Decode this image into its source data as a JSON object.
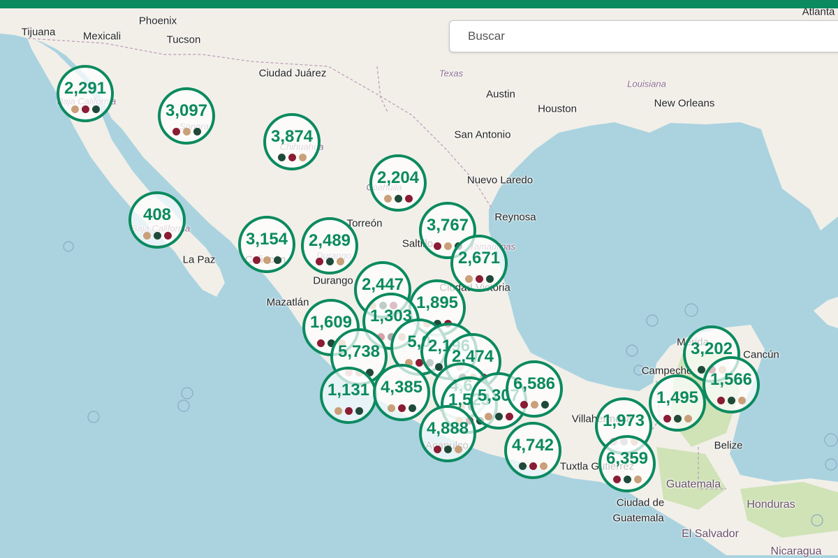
{
  "colors": {
    "topbar": "#0b8a5f",
    "accent": "#0b8a5f",
    "ocean": "#aad3df",
    "land": "#f2efe9",
    "land_alt": "#eae6dc",
    "forest": "#cfe3b6",
    "dots": {
      "tan": "#c9a07a",
      "maroon": "#8a1c33",
      "green": "#1f4a3a",
      "pink": "#d9a0a8",
      "gray": "#a8a8a8"
    }
  },
  "search": {
    "placeholder": "Buscar"
  },
  "places": [
    {
      "id": "tijuana",
      "label": "Tijuana"
    },
    {
      "id": "mexicali",
      "label": "Mexicali"
    },
    {
      "id": "phoenix",
      "label": "Phoenix"
    },
    {
      "id": "tucson",
      "label": "Tucson"
    },
    {
      "id": "ciudad-juarez",
      "label": "Ciudad Juárez"
    },
    {
      "id": "texas",
      "label": "Texas"
    },
    {
      "id": "austin",
      "label": "Austin"
    },
    {
      "id": "houston",
      "label": "Houston"
    },
    {
      "id": "louisiana",
      "label": "Louisiana"
    },
    {
      "id": "new-orleans",
      "label": "New Orleans"
    },
    {
      "id": "atlanta",
      "label": "Atlanta"
    },
    {
      "id": "san-antonio",
      "label": "San Antonio"
    },
    {
      "id": "nuevo-laredo",
      "label": "Nuevo Laredo"
    },
    {
      "id": "reynosa",
      "label": "Reynosa"
    },
    {
      "id": "torreon",
      "label": "Torreón"
    },
    {
      "id": "saltillo",
      "label": "Saltillo"
    },
    {
      "id": "la-paz",
      "label": "La Paz"
    },
    {
      "id": "durango",
      "label": "Durango"
    },
    {
      "id": "mazatlan",
      "label": "Mazatlán"
    },
    {
      "id": "ciudad-victoria",
      "label": "Ciudad Victoria"
    },
    {
      "id": "merida",
      "label": "Mérida"
    },
    {
      "id": "cancun",
      "label": "Cancún"
    },
    {
      "id": "campeche",
      "label": "Campeche"
    },
    {
      "id": "belize",
      "label": "Belize"
    },
    {
      "id": "villahermosa",
      "label": "Villahermosa"
    },
    {
      "id": "tuxtla",
      "label": "Tuxtla Gutiérrez"
    },
    {
      "id": "guatemala",
      "label": "Guatemala"
    },
    {
      "id": "ciudad-de-guatemala-1",
      "label": "Ciudad de"
    },
    {
      "id": "ciudad-de-guatemala-2",
      "label": "Guatemala"
    },
    {
      "id": "honduras",
      "label": "Honduras"
    },
    {
      "id": "el-salvador",
      "label": "El Salvador"
    },
    {
      "id": "nicaragua",
      "label": "Nicaragua"
    },
    {
      "id": "acapulco",
      "label": "Acapulco"
    },
    {
      "id": "baja-california",
      "label": "Baja California"
    },
    {
      "id": "baja-california-sur",
      "label": "Baja California"
    },
    {
      "id": "sonora",
      "label": "Sonora"
    },
    {
      "id": "chihuahua",
      "label": "Chihuahua"
    },
    {
      "id": "coahuila",
      "label": "Coahuila"
    },
    {
      "id": "durango-state",
      "label": "Durango"
    },
    {
      "id": "culiacan",
      "label": "Culiacán"
    },
    {
      "id": "tamaulipas",
      "label": "Tamaulipas"
    }
  ],
  "clusters": [
    {
      "id": "baja-california",
      "count": "2,291",
      "dots": [
        "tan",
        "maroon",
        "green"
      ]
    },
    {
      "id": "sonora",
      "count": "3,097",
      "dots": [
        "maroon",
        "tan",
        "green"
      ]
    },
    {
      "id": "chihuahua",
      "count": "3,874",
      "dots": [
        "green",
        "maroon",
        "tan"
      ]
    },
    {
      "id": "coahuila",
      "count": "2,204",
      "dots": [
        "tan",
        "green",
        "maroon"
      ]
    },
    {
      "id": "baja-california-sur",
      "count": "408",
      "dots": [
        "tan",
        "green",
        "maroon"
      ]
    },
    {
      "id": "sinaloa",
      "count": "3,154",
      "dots": [
        "maroon",
        "tan",
        "green"
      ]
    },
    {
      "id": "durango",
      "count": "2,489",
      "dots": [
        "maroon",
        "green",
        "tan"
      ]
    },
    {
      "id": "nuevo-leon",
      "count": "3,767",
      "dots": [
        "maroon",
        "tan",
        "green"
      ]
    },
    {
      "id": "tamaulipas",
      "count": "2,671",
      "dots": [
        "tan",
        "maroon",
        "green"
      ]
    },
    {
      "id": "zacatecas",
      "count": "2,447",
      "dots": [
        "tan",
        "green",
        "maroon"
      ]
    },
    {
      "id": "san-luis-potosi",
      "count": "1,895",
      "dots": [
        "tan",
        "green",
        "maroon"
      ]
    },
    {
      "id": "aguascalientes",
      "count": "1,303",
      "dots": [
        "pink",
        "gray",
        "tan"
      ]
    },
    {
      "id": "nayarit",
      "count": "1,609",
      "dots": [
        "maroon",
        "green",
        "tan"
      ]
    },
    {
      "id": "jalisco",
      "count": "5,738",
      "dots": [
        "pink",
        "tan",
        "green"
      ]
    },
    {
      "id": "guanajuato",
      "count": "5,0",
      "dots": [
        "tan",
        "maroon",
        "green"
      ]
    },
    {
      "id": "queretaro",
      "count": "2,196",
      "dots": [
        "green",
        "tan",
        "maroon"
      ]
    },
    {
      "id": "hidalgo",
      "count": "2,474",
      "dots": [
        "green",
        "tan",
        "maroon"
      ]
    },
    {
      "id": "colima",
      "count": "1,131",
      "dots": [
        "tan",
        "maroon",
        "green"
      ]
    },
    {
      "id": "michoacan",
      "count": "4,385",
      "dots": [
        "tan",
        "maroon",
        "green"
      ]
    },
    {
      "id": "edomex",
      "count": "4,6",
      "dots": [
        "pink",
        "tan",
        "green"
      ]
    },
    {
      "id": "morelos",
      "count": "1,523",
      "dots": [
        "tan",
        "maroon",
        "green"
      ]
    },
    {
      "id": "puebla",
      "count": "5,307",
      "dots": [
        "tan",
        "green",
        "maroon"
      ]
    },
    {
      "id": "veracruz",
      "count": "6,586",
      "dots": [
        "maroon",
        "tan",
        "green"
      ]
    },
    {
      "id": "guerrero",
      "count": "4,888",
      "dots": [
        "maroon",
        "green",
        "tan"
      ]
    },
    {
      "id": "oaxaca",
      "count": "4,742",
      "dots": [
        "green",
        "maroon",
        "tan"
      ]
    },
    {
      "id": "tabasco",
      "count": "1,973",
      "dots": [
        "pink",
        "gray",
        "tan"
      ]
    },
    {
      "id": "chiapas",
      "count": "6,359",
      "dots": [
        "maroon",
        "green",
        "tan"
      ]
    },
    {
      "id": "campeche",
      "count": "1,495",
      "dots": [
        "maroon",
        "green",
        "tan"
      ]
    },
    {
      "id": "yucatan",
      "count": "3,202",
      "dots": [
        "green",
        "maroon",
        "tan"
      ]
    },
    {
      "id": "quintana-roo",
      "count": "1,566",
      "dots": [
        "maroon",
        "green",
        "tan"
      ]
    }
  ]
}
